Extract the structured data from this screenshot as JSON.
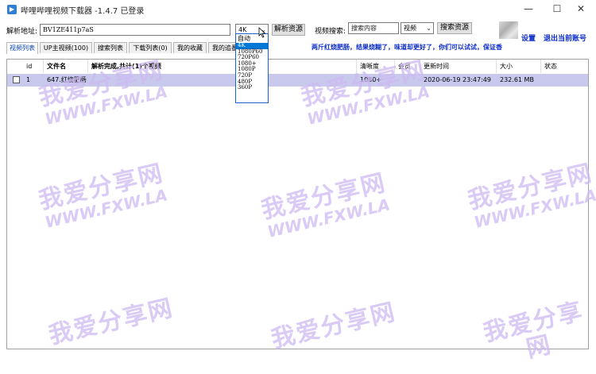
{
  "window": {
    "title": "哔哩哔哩视频下载器 -1.4.7   已登录",
    "min_icon": "—",
    "max_icon": "☐",
    "close_icon": "✕"
  },
  "toolbar": {
    "url_label": "解析地址:",
    "url_value": "BV1ZE411p7aS",
    "quality_value": "4K",
    "quality_options": [
      "自动",
      "4K",
      "1080P60",
      "720P60",
      "1080+",
      "1080P",
      "720P",
      "480P",
      "360P"
    ],
    "parse_button": "解析资源",
    "search_label": "视频搜索:",
    "search_placeholder": "搜索内容",
    "search_type": "视频",
    "search_button": "搜索资源",
    "settings_link": "设置",
    "logout_link": "退出当前账号"
  },
  "tabs": [
    "视频列表",
    "UP主视频(100)",
    "搜索列表",
    "下载列表(0)",
    "我的收藏",
    "我的追番"
  ],
  "notice": "两斤红烧肥肠，结果烧糊了，味道却更好了，你们可以试试，保证香",
  "table": {
    "columns": [
      "id",
      "文件名",
      "解析完成,共计(1)个视频",
      "清晰度",
      "会员",
      "更新时间",
      "大小",
      "状态"
    ],
    "rows": [
      {
        "id": "1",
        "name": "647.红烧肥肠",
        "quality": "1080+",
        "vip": "",
        "time": "2020-06-19 23:47:49",
        "size": "232.61 MB",
        "status": ""
      }
    ]
  },
  "watermark": {
    "cn": "我爱分享网",
    "en": "WWW.FXW.LA"
  },
  "colors": {
    "link": "#0a2cc8",
    "selected_row": "#c9c9ee",
    "dropdown_highlight": "#0078d7"
  }
}
